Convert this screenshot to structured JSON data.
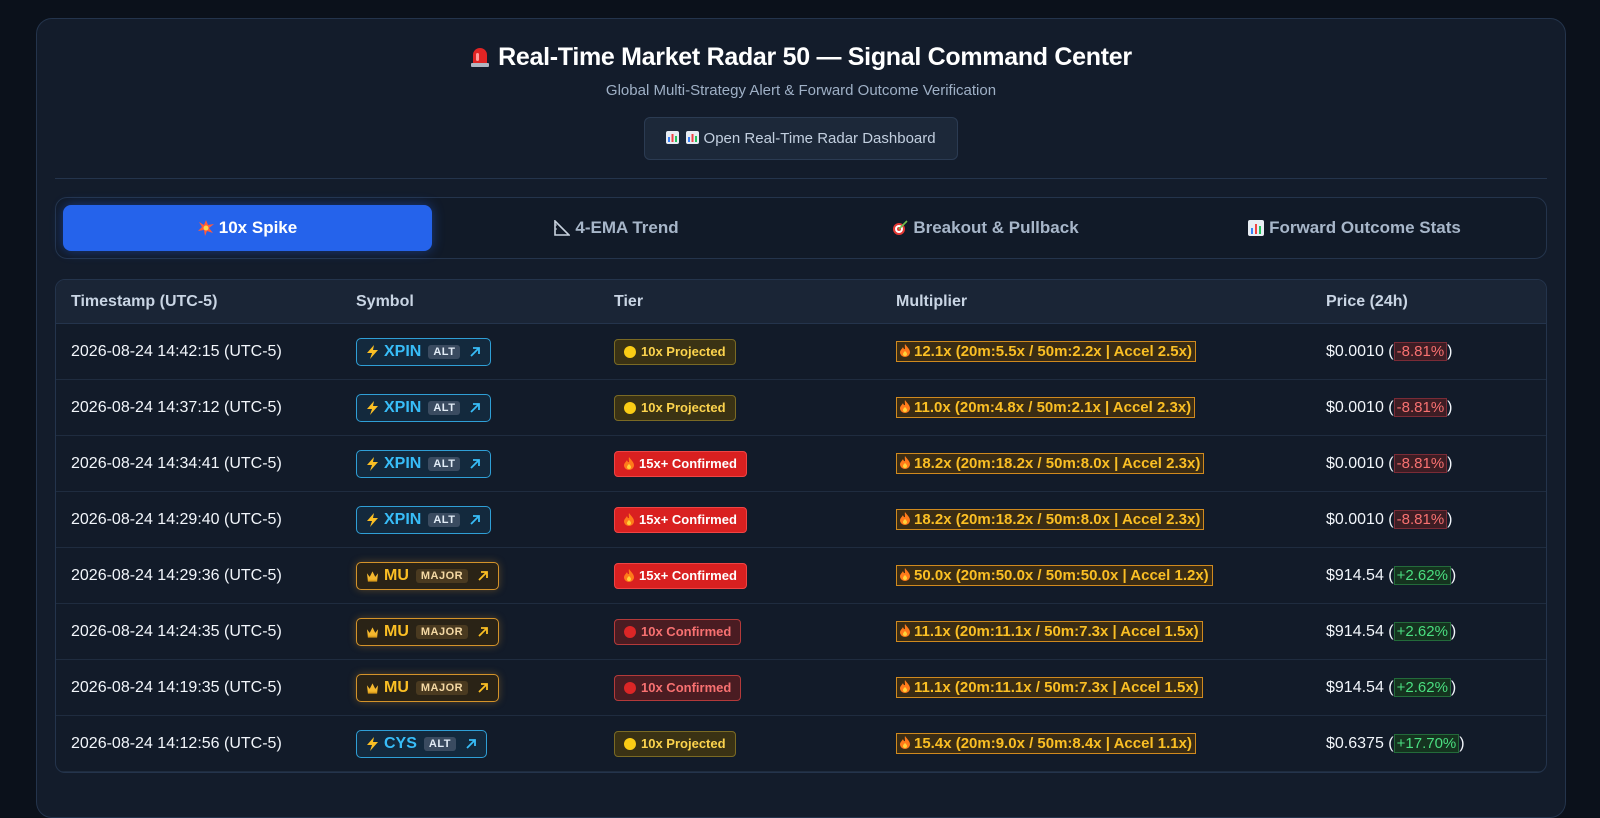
{
  "header": {
    "title": "Real-Time Market Radar 50 — Signal Command Center",
    "subtitle": "Global Multi-Strategy Alert & Forward Outcome Verification",
    "open_button": "Open Real-Time Radar Dashboard"
  },
  "tabs": [
    {
      "label": "10x Spike",
      "icon": "explosion-icon",
      "active": true
    },
    {
      "label": "4-EMA Trend",
      "icon": "triangle-ruler-icon",
      "active": false
    },
    {
      "label": "Breakout & Pullback",
      "icon": "target-icon",
      "active": false
    },
    {
      "label": "Forward Outcome Stats",
      "icon": "bar-chart-icon",
      "active": false
    }
  ],
  "table": {
    "headers": [
      "Timestamp (UTC-5)",
      "Symbol",
      "Tier",
      "Multiplier",
      "Price (24h)"
    ],
    "rows": [
      {
        "time": "2026-08-24 14:42:15 (UTC-5)",
        "symbol": "XPIN",
        "class": "ALT",
        "tier": "10x Projected",
        "multiplier": "12.1x (20m:5.5x / 50m:2.2x | Accel 2.5x)",
        "price": "$0.0010",
        "change": "-8.81%"
      },
      {
        "time": "2026-08-24 14:37:12 (UTC-5)",
        "symbol": "XPIN",
        "class": "ALT",
        "tier": "10x Projected",
        "multiplier": "11.0x (20m:4.8x / 50m:2.1x | Accel 2.3x)",
        "price": "$0.0010",
        "change": "-8.81%"
      },
      {
        "time": "2026-08-24 14:34:41 (UTC-5)",
        "symbol": "XPIN",
        "class": "ALT",
        "tier": "15x+ Confirmed",
        "multiplier": "18.2x (20m:18.2x / 50m:8.0x | Accel 2.3x)",
        "price": "$0.0010",
        "change": "-8.81%"
      },
      {
        "time": "2026-08-24 14:29:40 (UTC-5)",
        "symbol": "XPIN",
        "class": "ALT",
        "tier": "15x+ Confirmed",
        "multiplier": "18.2x (20m:18.2x / 50m:8.0x | Accel 2.3x)",
        "price": "$0.0010",
        "change": "-8.81%"
      },
      {
        "time": "2026-08-24 14:29:36 (UTC-5)",
        "symbol": "MU",
        "class": "MAJOR",
        "tier": "15x+ Confirmed",
        "multiplier": "50.0x (20m:50.0x / 50m:50.0x | Accel 1.2x)",
        "price": "$914.54",
        "change": "+2.62%"
      },
      {
        "time": "2026-08-24 14:24:35 (UTC-5)",
        "symbol": "MU",
        "class": "MAJOR",
        "tier": "10x Confirmed",
        "multiplier": "11.1x (20m:11.1x / 50m:7.3x | Accel 1.5x)",
        "price": "$914.54",
        "change": "+2.62%"
      },
      {
        "time": "2026-08-24 14:19:35 (UTC-5)",
        "symbol": "MU",
        "class": "MAJOR",
        "tier": "10x Confirmed",
        "multiplier": "11.1x (20m:11.1x / 50m:7.3x | Accel 1.5x)",
        "price": "$914.54",
        "change": "+2.62%"
      },
      {
        "time": "2026-08-24 14:12:56 (UTC-5)",
        "symbol": "CYS",
        "class": "ALT",
        "tier": "10x Projected",
        "multiplier": "15.4x (20m:9.0x / 50m:8.4x | Accel 1.1x)",
        "price": "$0.6375",
        "change": "+17.70%"
      }
    ]
  },
  "colors": {
    "accent": "#2563eb",
    "alt_symbol": "#38bdf8",
    "major_symbol": "#fbbf24",
    "negative": "#f87171",
    "positive": "#4ade80",
    "multiplier": "#fbbf24"
  }
}
